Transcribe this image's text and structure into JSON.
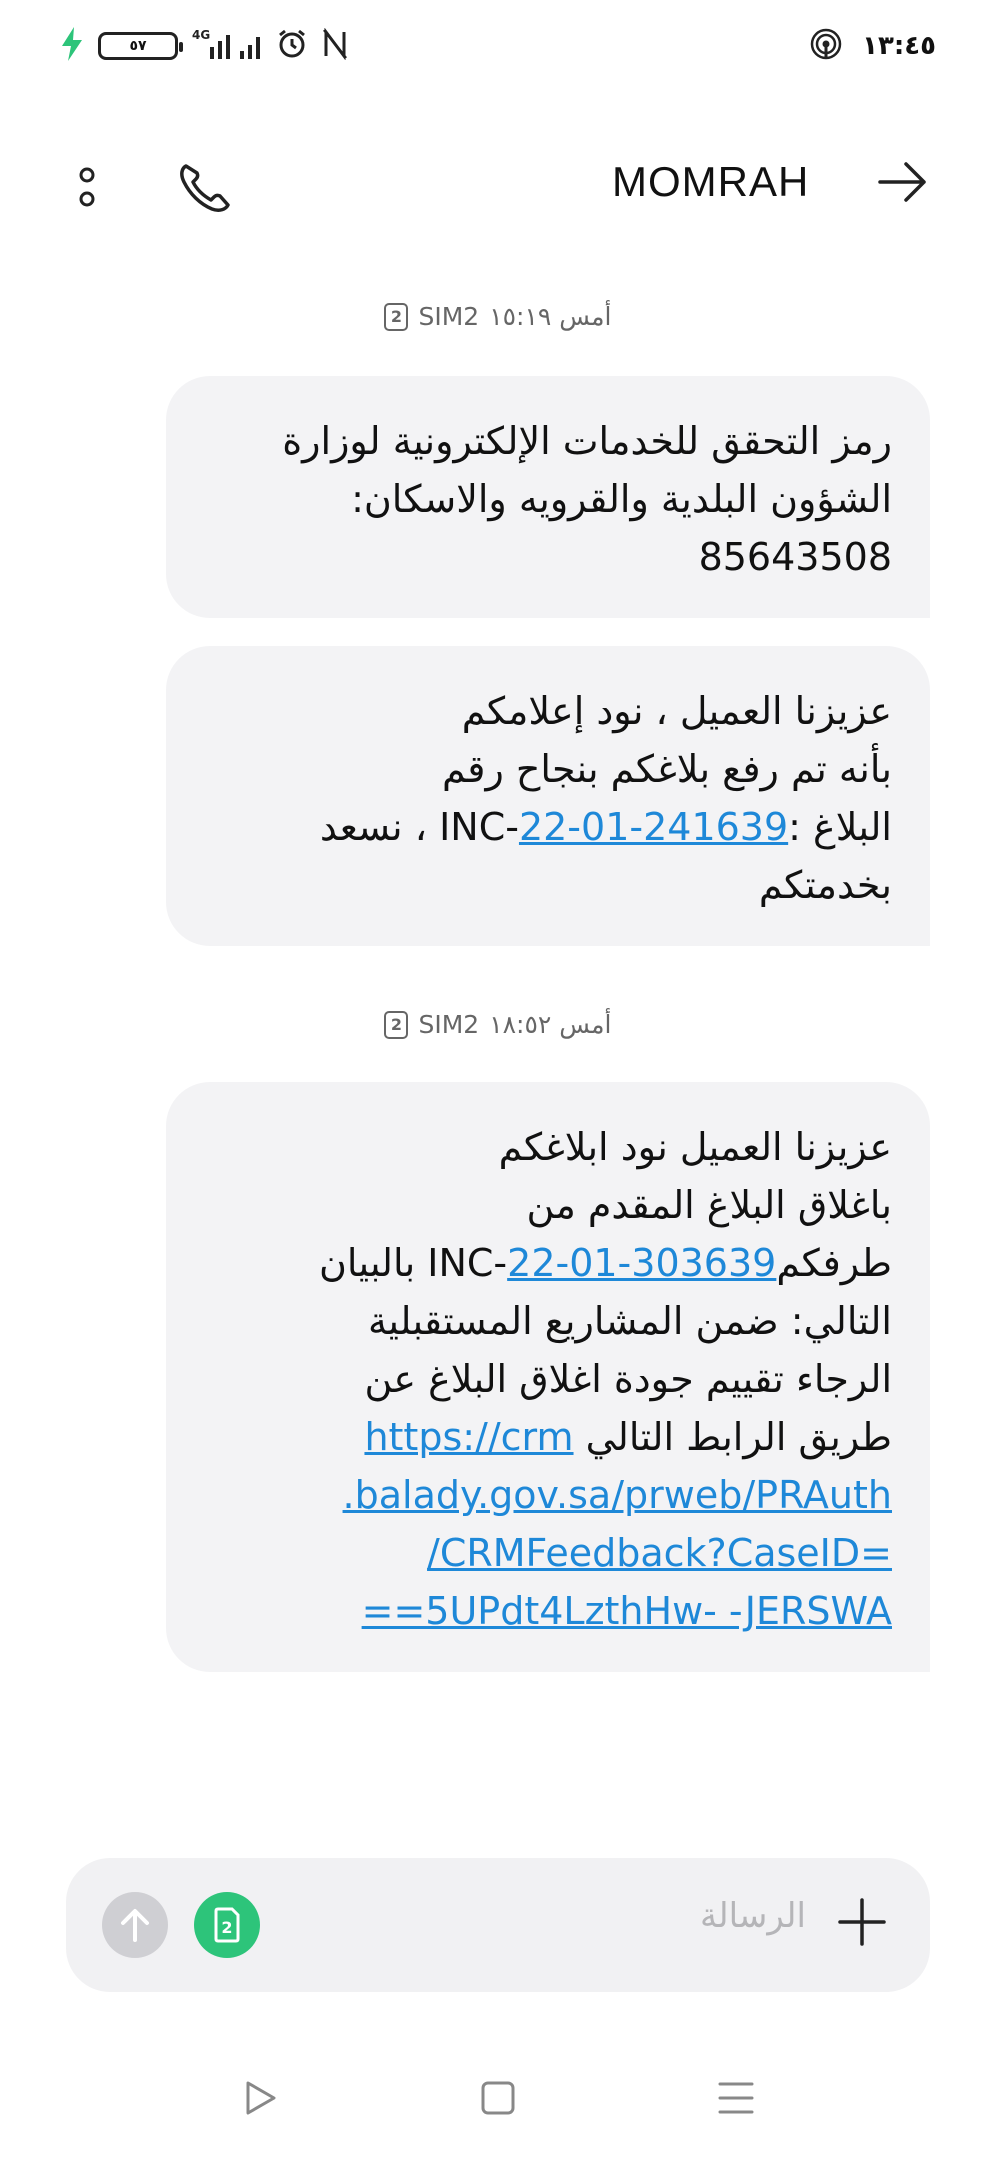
{
  "status_bar": {
    "time": "١٣:٤٥",
    "battery_level": "٥٧",
    "network": "4G"
  },
  "header": {
    "title": "MOMRAH"
  },
  "separators": [
    {
      "label": "أمس ١٥:١٩",
      "sim": "SIM2",
      "sim_number": "2"
    },
    {
      "label": "أمس ١٨:٥٢",
      "sim": "SIM2",
      "sim_number": "2"
    }
  ],
  "messages": [
    {
      "line1": "رمز التحقق للخدمات الإلكترونية لوزارة",
      "line2": "الشؤون البلدية والقرويه والاسكان:",
      "line3": "85643508"
    },
    {
      "line1": "عزيزنا العميل ، نود إعلامكم",
      "line2": "بأنه تم رفع بلاغكم بنجاح رقم",
      "line3_prefix": "البلاغ :",
      "line3_code": "INC-",
      "line3_link": "22-01-241639",
      "line3_suffix": "، نسعد",
      "line4": "بخدمتكم"
    },
    {
      "line1": "عزيزنا العميل نود ابلاغكم",
      "line2": "باغلاق البلاغ المقدم من",
      "line3_prefix": "طرفكم",
      "line3_code": "INC-",
      "line3_link": "22-01-303639",
      "line3_suffix": "بالبيان",
      "line4": "التالي: ضمن المشاريع المستقبلية",
      "line5": "الرجاء تقييم جودة اغلاق البلاغ عن",
      "line6_text": "طريق الرابط التالي",
      "line6_link": "https://crm",
      "link_line1": ".balady.gov.sa/prweb/PRAuth",
      "link_line2": "/CRMFeedback?CaseID=",
      "link_line3": "==5UPdt4LzthHw-  -JERSWA"
    }
  ],
  "input": {
    "placeholder": "الرسالة",
    "sim_number": "2"
  },
  "colors": {
    "link": "#1e88d8",
    "bubble": "#f3f3f5",
    "sim_button": "#2dc47a",
    "charging": "#2dc47a"
  },
  "icons": [
    "charging-icon",
    "battery-icon",
    "signal-icon",
    "alarm-icon",
    "nfc-icon",
    "hotspot-icon",
    "back-arrow-icon",
    "phone-icon",
    "more-icon",
    "send-icon",
    "sim-icon",
    "plus-icon",
    "recent-apps-icon",
    "home-icon",
    "menu-icon"
  ]
}
